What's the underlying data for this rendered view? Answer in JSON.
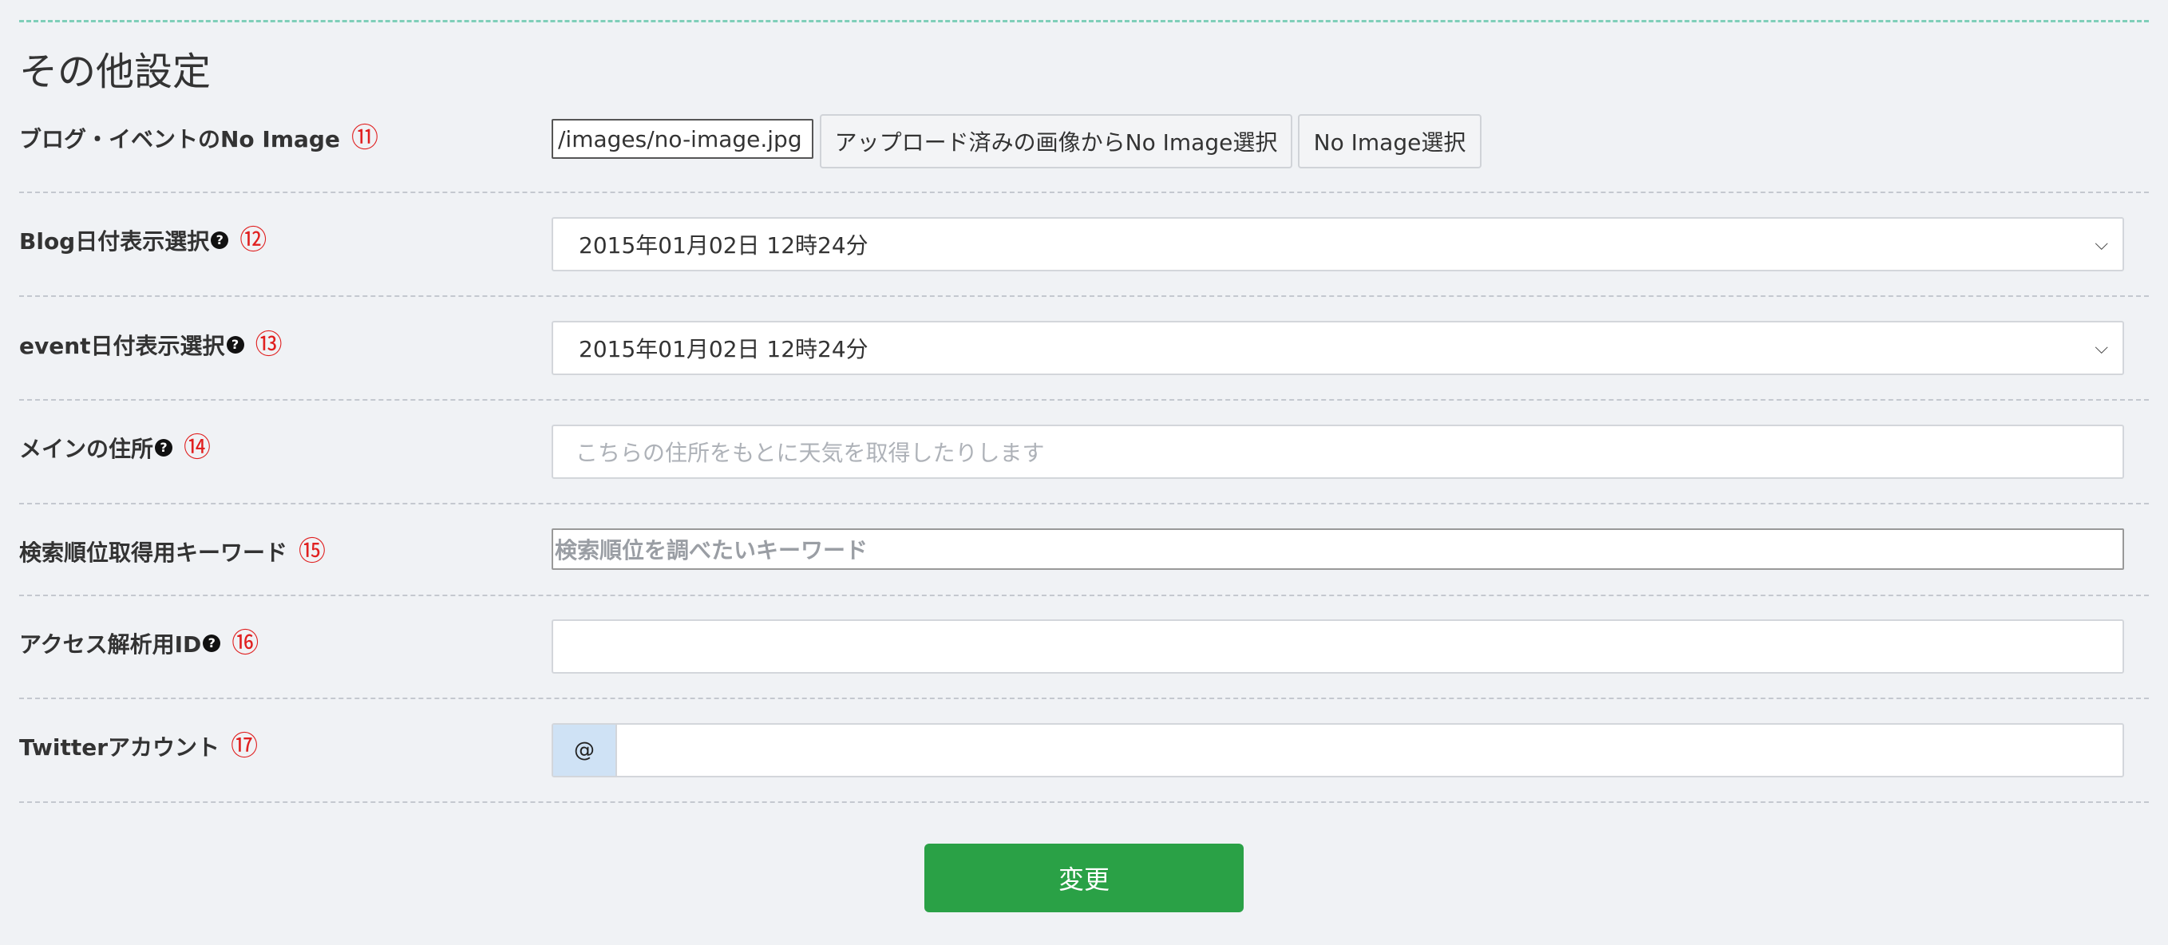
{
  "section": {
    "title": "その他設定"
  },
  "rows": {
    "noimage": {
      "label": "ブログ・イベントのNo Image",
      "num": "⑪",
      "value": "/images/no-image.jpg",
      "btn_uploaded": "アップロード済みの画像からNo Image選択",
      "btn_select": "No Image選択"
    },
    "blog_date": {
      "label": "Blog日付表示選択",
      "num": "⑫",
      "selected": "2015年01月02日 12時24分"
    },
    "event_date": {
      "label": "event日付表示選択",
      "num": "⑬",
      "selected": "2015年01月02日 12時24分"
    },
    "address": {
      "label": "メインの住所",
      "num": "⑭",
      "placeholder": "こちらの住所をもとに天気を取得したりします"
    },
    "keyword": {
      "label": "検索順位取得用キーワード",
      "num": "⑮",
      "placeholder": "検索順位を調べたいキーワード"
    },
    "analytics": {
      "label": "アクセス解析用ID",
      "num": "⑯",
      "value": ""
    },
    "twitter": {
      "label": "Twitterアカウント",
      "num": "⑰",
      "prefix": "@",
      "value": ""
    }
  },
  "submit": {
    "label": "変更"
  },
  "colors": {
    "accent_green": "#2aa146",
    "number_red": "#e02020",
    "top_rule": "#7fcfb9",
    "prefix_bg": "#cfe2f5"
  },
  "icons": {
    "help": "question-circle-icon",
    "caret": "chevron-down-icon"
  }
}
